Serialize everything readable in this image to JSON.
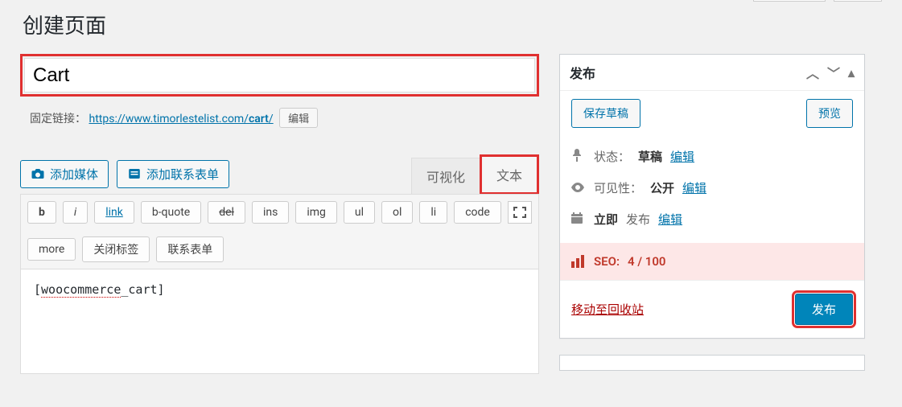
{
  "page_title": "创建页面",
  "title_input_value": "Cart",
  "permalink": {
    "label": "固定链接：",
    "url_prefix": "https://www.timorlestelist.com/",
    "slug": "cart",
    "url_suffix": "/",
    "edit_label": "编辑"
  },
  "media_buttons": {
    "add_media": "添加媒体",
    "add_contact_form": "添加联系表单"
  },
  "tabs": {
    "visual": "可视化",
    "text": "文本"
  },
  "quicktags": [
    "b",
    "i",
    "link",
    "b-quote",
    "del",
    "ins",
    "img",
    "ul",
    "ol",
    "li",
    "code",
    "more",
    "关闭标签",
    "联系表单"
  ],
  "editor_content": "[woocommerce_cart]",
  "publish_box": {
    "title": "发布",
    "save_draft": "保存草稿",
    "preview": "预览",
    "status": {
      "label": "状态：",
      "value": "草稿",
      "edit": "编辑"
    },
    "visibility": {
      "label": "可见性：",
      "value": "公开",
      "edit": "编辑"
    },
    "schedule": {
      "prefix": "立即",
      "suffix": "发布",
      "edit": "编辑"
    },
    "seo": {
      "label": "SEO:",
      "score": "4 / 100"
    },
    "trash": "移动至回收站",
    "publish": "发布"
  }
}
